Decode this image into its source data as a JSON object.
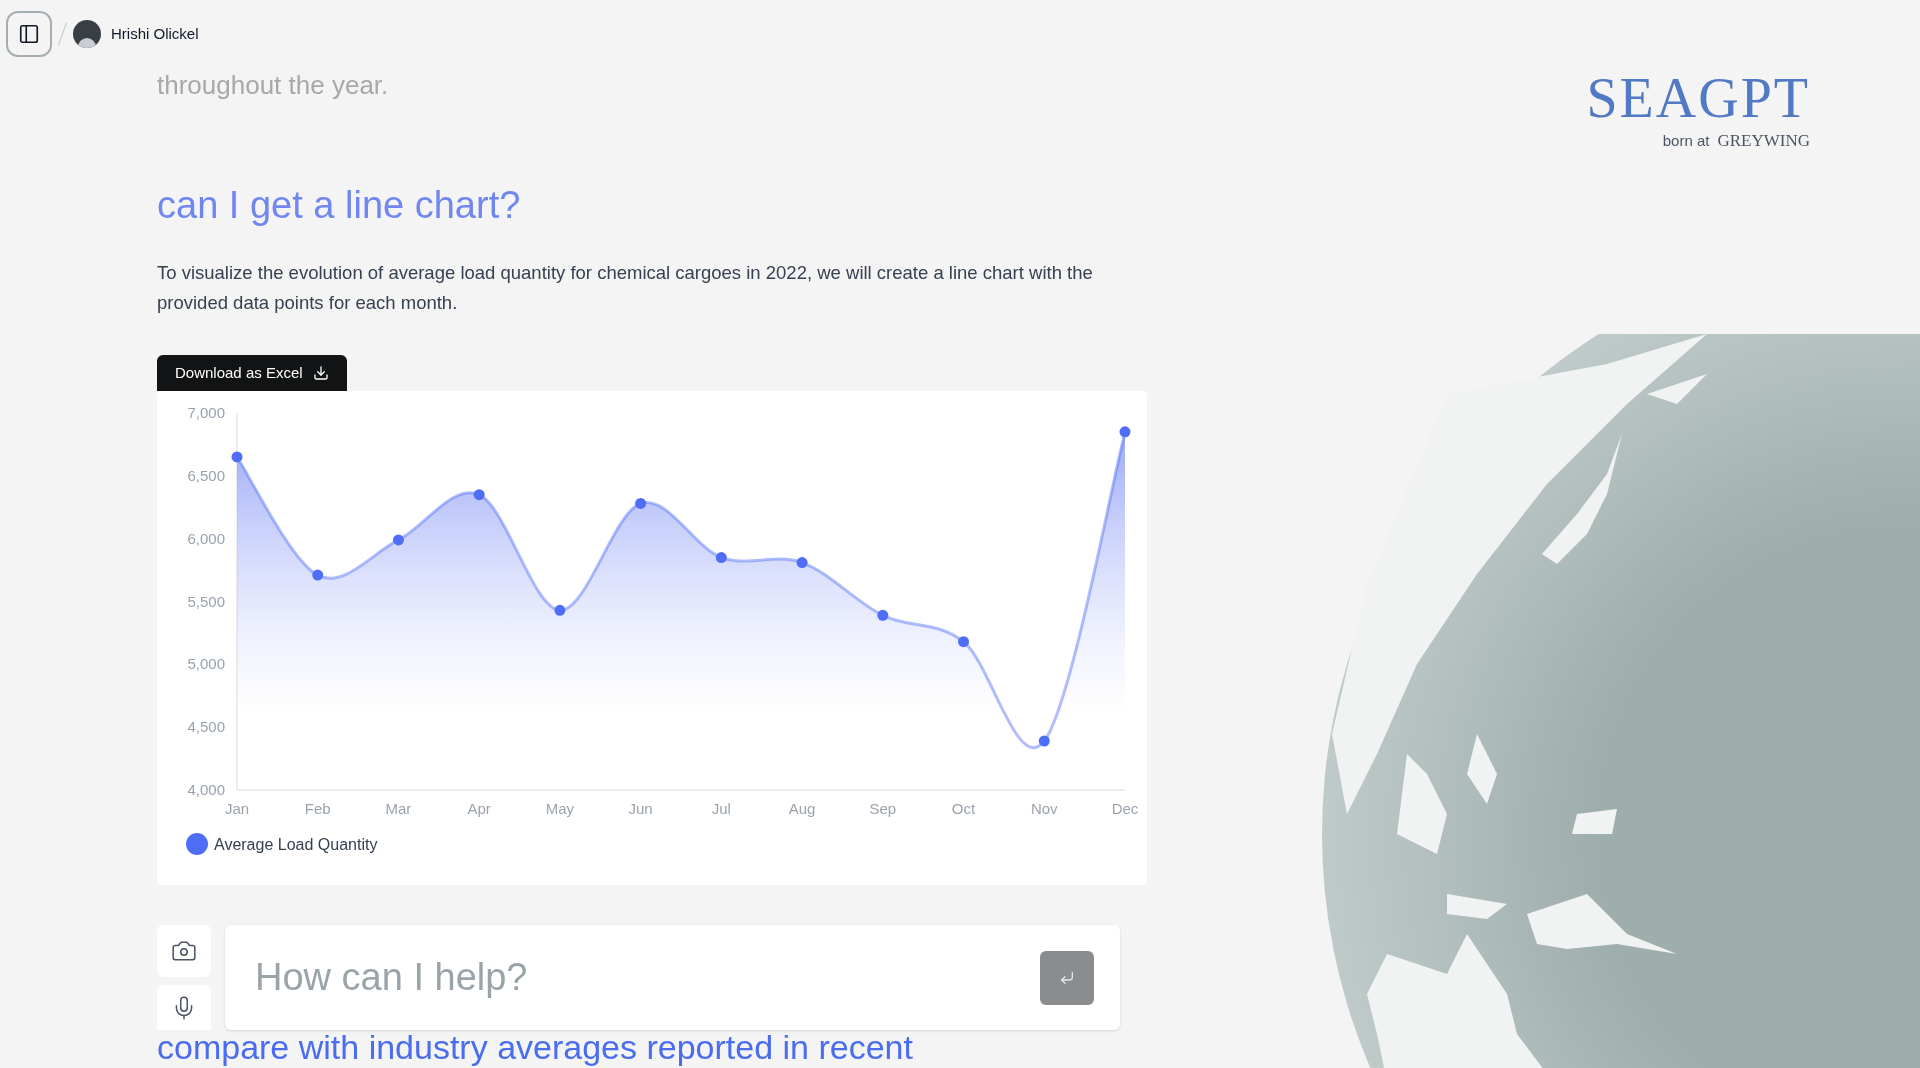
{
  "header": {
    "user_name": "Hrishi Olickel"
  },
  "logo": {
    "name": "SEAGPT",
    "tagline": "born at",
    "company": "GREYWING"
  },
  "conversation": {
    "faded_text": "throughout the year.",
    "question": "can I get a line chart?",
    "answer": "To visualize the evolution of average load quantity for chemical cargoes in 2022, we will create a line chart with the provided data points for each month.",
    "download_button": "Download as Excel",
    "chart_data": {
      "type": "area",
      "categories": [
        "Jan",
        "Feb",
        "Mar",
        "Apr",
        "May",
        "Jun",
        "Jul",
        "Aug",
        "Sep",
        "Oct",
        "Nov",
        "Dec"
      ],
      "series": [
        {
          "name": "Average Load Quantity",
          "color": "#4f6ef7",
          "values": [
            6650,
            5710,
            5990,
            6350,
            5430,
            6280,
            5850,
            5810,
            5390,
            5180,
            4390,
            6850
          ]
        }
      ],
      "ylim": [
        4000,
        7000
      ],
      "yticks": [
        {
          "value": 4000,
          "label": "4,000"
        },
        {
          "value": 4500,
          "label": "4,500"
        },
        {
          "value": 5000,
          "label": "5,000"
        },
        {
          "value": 5500,
          "label": "5,500"
        },
        {
          "value": 6000,
          "label": "6,000"
        },
        {
          "value": 6500,
          "label": "6,500"
        },
        {
          "value": 7000,
          "label": "7,000"
        }
      ]
    },
    "trailing_text": "compare with industry averages reported in recent"
  },
  "composer": {
    "placeholder": "How can I help?"
  }
}
